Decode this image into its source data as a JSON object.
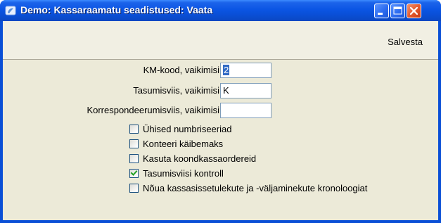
{
  "window": {
    "title": "Demo: Kassaraamatu seadistused: Vaata"
  },
  "toolbar": {
    "save_label": "Salvesta"
  },
  "fields": [
    {
      "label": "KM-kood, vaikimisi",
      "value": "2",
      "selected": true
    },
    {
      "label": "Tasumisviis, vaikimisi",
      "value": "K",
      "selected": false
    },
    {
      "label": "Korrespondeerumisviis, vaikimisi",
      "value": "",
      "selected": false
    }
  ],
  "checkboxes": [
    {
      "label": "Ühised numbriseeriad",
      "checked": false
    },
    {
      "label": "Konteeri käibemaks",
      "checked": false
    },
    {
      "label": "Kasuta koondkassaordereid",
      "checked": false
    },
    {
      "label": "Tasumisviisi kontroll",
      "checked": true
    },
    {
      "label": "Nõua kassasissetulekute ja -väljaminekute kronoloogiat",
      "checked": false
    }
  ],
  "colors": {
    "titlebar": "#0a4fd6",
    "client_background": "#ecead8",
    "selection": "#316ac5",
    "checkmark": "#21a121"
  }
}
